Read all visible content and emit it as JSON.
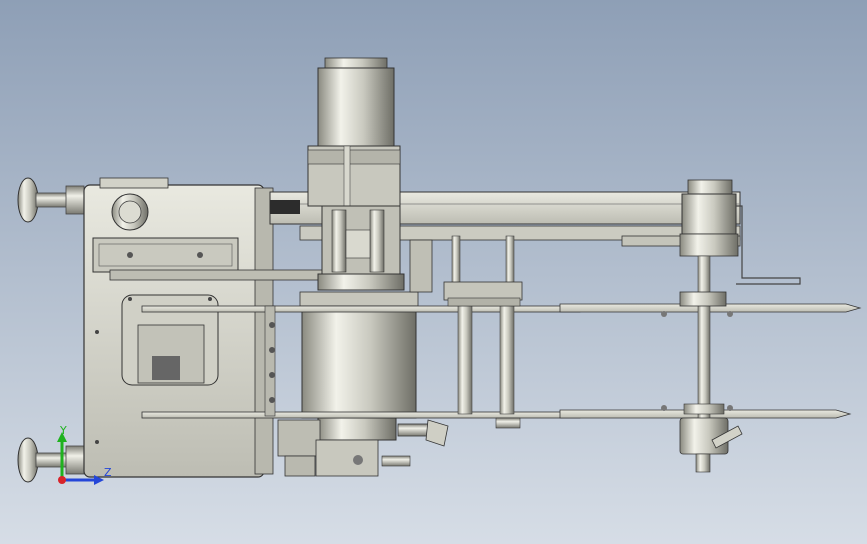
{
  "viewport": {
    "background_top": "#8e9fb6",
    "background_bottom": "#d6dde6"
  },
  "triad": {
    "y_label": "Y",
    "z_label": "Z",
    "y_color": "#1fb21f",
    "z_color": "#2446d8",
    "x_color": "#d8242a"
  },
  "model": {
    "part_color_light": "#e6e6dc",
    "part_color_dark": "#9a9a90",
    "plate_color": "#cfcfc5"
  }
}
